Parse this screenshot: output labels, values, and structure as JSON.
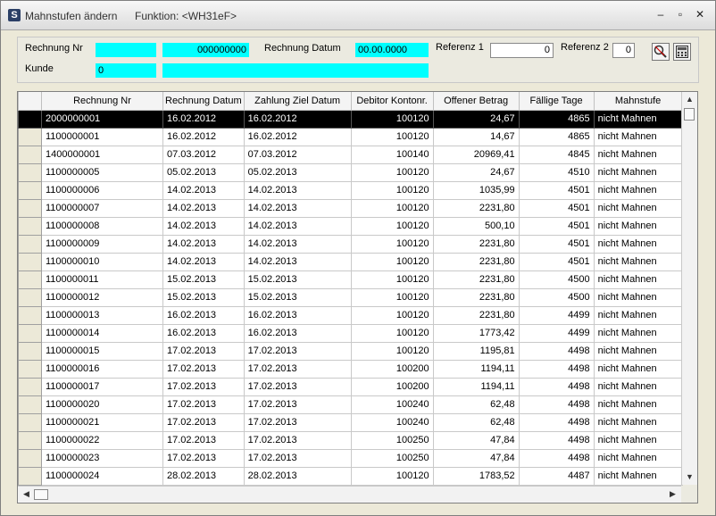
{
  "window": {
    "title": "Mahnstufen ändern",
    "function_label": "Funktion: <WH31eF>",
    "icon_letter": "S",
    "minimize": "–",
    "maximize": "▫",
    "close": "✕"
  },
  "filters": {
    "rechnung_nr_label": "Rechnung Nr",
    "rechnung_nr_value": "",
    "rechnung_nr_to": "000000000",
    "rechnung_datum_label": "Rechnung Datum",
    "rechnung_datum_value": "00.00.0000",
    "referenz1_label": "Referenz 1",
    "referenz1_value": "0",
    "referenz2_label": "Referenz 2",
    "referenz2_value": "0",
    "kunde_label": "Kunde",
    "kunde_value": "0",
    "kunde_name": ""
  },
  "table": {
    "columns": [
      "Rechnung Nr",
      "Rechnung Datum",
      "Zahlung Ziel Datum",
      "Debitor Kontonr.",
      "Offener Betrag",
      "Fällige Tage",
      "Mahnstufe"
    ],
    "rows": [
      [
        "2000000001",
        "16.02.2012",
        "16.02.2012",
        "100120",
        "24,67",
        "4865",
        "nicht Mahnen"
      ],
      [
        "1100000001",
        "16.02.2012",
        "16.02.2012",
        "100120",
        "14,67",
        "4865",
        "nicht Mahnen"
      ],
      [
        "1400000001",
        "07.03.2012",
        "07.03.2012",
        "100140",
        "20969,41",
        "4845",
        "nicht Mahnen"
      ],
      [
        "1100000005",
        "05.02.2013",
        "05.02.2013",
        "100120",
        "24,67",
        "4510",
        "nicht Mahnen"
      ],
      [
        "1100000006",
        "14.02.2013",
        "14.02.2013",
        "100120",
        "1035,99",
        "4501",
        "nicht Mahnen"
      ],
      [
        "1100000007",
        "14.02.2013",
        "14.02.2013",
        "100120",
        "2231,80",
        "4501",
        "nicht Mahnen"
      ],
      [
        "1100000008",
        "14.02.2013",
        "14.02.2013",
        "100120",
        "500,10",
        "4501",
        "nicht Mahnen"
      ],
      [
        "1100000009",
        "14.02.2013",
        "14.02.2013",
        "100120",
        "2231,80",
        "4501",
        "nicht Mahnen"
      ],
      [
        "1100000010",
        "14.02.2013",
        "14.02.2013",
        "100120",
        "2231,80",
        "4501",
        "nicht Mahnen"
      ],
      [
        "1100000011",
        "15.02.2013",
        "15.02.2013",
        "100120",
        "2231,80",
        "4500",
        "nicht Mahnen"
      ],
      [
        "1100000012",
        "15.02.2013",
        "15.02.2013",
        "100120",
        "2231,80",
        "4500",
        "nicht Mahnen"
      ],
      [
        "1100000013",
        "16.02.2013",
        "16.02.2013",
        "100120",
        "2231,80",
        "4499",
        "nicht Mahnen"
      ],
      [
        "1100000014",
        "16.02.2013",
        "16.02.2013",
        "100120",
        "1773,42",
        "4499",
        "nicht Mahnen"
      ],
      [
        "1100000015",
        "17.02.2013",
        "17.02.2013",
        "100120",
        "1195,81",
        "4498",
        "nicht Mahnen"
      ],
      [
        "1100000016",
        "17.02.2013",
        "17.02.2013",
        "100200",
        "1194,11",
        "4498",
        "nicht Mahnen"
      ],
      [
        "1100000017",
        "17.02.2013",
        "17.02.2013",
        "100200",
        "1194,11",
        "4498",
        "nicht Mahnen"
      ],
      [
        "1100000020",
        "17.02.2013",
        "17.02.2013",
        "100240",
        "62,48",
        "4498",
        "nicht Mahnen"
      ],
      [
        "1100000021",
        "17.02.2013",
        "17.02.2013",
        "100240",
        "62,48",
        "4498",
        "nicht Mahnen"
      ],
      [
        "1100000022",
        "17.02.2013",
        "17.02.2013",
        "100250",
        "47,84",
        "4498",
        "nicht Mahnen"
      ],
      [
        "1100000023",
        "17.02.2013",
        "17.02.2013",
        "100250",
        "47,84",
        "4498",
        "nicht Mahnen"
      ],
      [
        "1100000024",
        "28.02.2013",
        "28.02.2013",
        "100120",
        "1783,52",
        "4487",
        "nicht Mahnen"
      ]
    ],
    "selected_row": 0
  },
  "icons": {
    "search": "search-magnifier-icon",
    "calculator": "calculator-icon"
  }
}
